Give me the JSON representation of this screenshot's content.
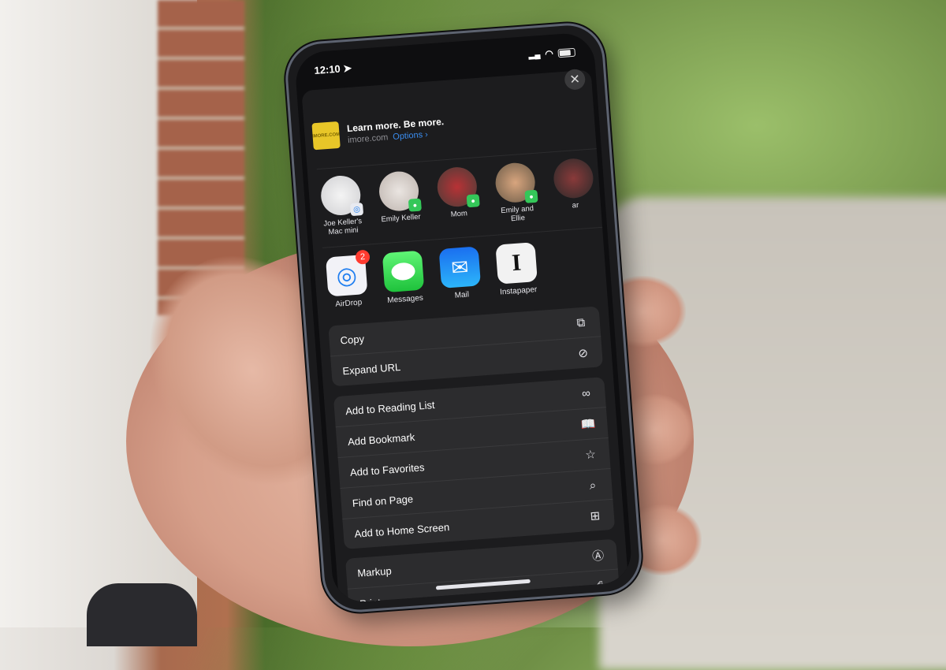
{
  "status_bar": {
    "time": "12:10",
    "location_arrow": "location-arrow-icon",
    "signal": "signal-icon",
    "wifi": "wifi-icon",
    "battery": "battery-icon"
  },
  "share_header": {
    "title": "Learn more. Be more.",
    "domain": "imore.com",
    "options_label": "Options ›",
    "thumbnail_label": "IMORE.COM",
    "close_label": "✕"
  },
  "people": [
    {
      "name": "Joe Keller's Mac mini",
      "badge": "airdrop"
    },
    {
      "name": "Emily Keller",
      "badge": "messages"
    },
    {
      "name": "Mom",
      "badge": "messages"
    },
    {
      "name": "Emily and Ellie",
      "badge": "messages"
    },
    {
      "name": "ar",
      "badge": "messages"
    }
  ],
  "apps": [
    {
      "name": "AirDrop",
      "badge_count": "2",
      "color": "#f2f2f7"
    },
    {
      "name": "Messages",
      "color": "#34c759"
    },
    {
      "name": "Mail",
      "color": "#1f8ef1"
    },
    {
      "name": "Instapaper",
      "color": "#f2f2f2",
      "glyph": "I"
    }
  ],
  "action_groups": [
    [
      {
        "label": "Copy",
        "icon": "⧉",
        "icon_name": "copy-icon"
      },
      {
        "label": "Expand URL",
        "icon": "⊘",
        "icon_name": "compass-icon"
      }
    ],
    [
      {
        "label": "Add to Reading List",
        "icon": "∞",
        "icon_name": "glasses-icon"
      },
      {
        "label": "Add Bookmark",
        "icon": "📖",
        "icon_name": "book-icon"
      },
      {
        "label": "Add to Favorites",
        "icon": "☆",
        "icon_name": "star-icon"
      },
      {
        "label": "Find on Page",
        "icon": "⌕",
        "icon_name": "search-icon"
      },
      {
        "label": "Add to Home Screen",
        "icon": "⊞",
        "icon_name": "add-square-icon"
      }
    ],
    [
      {
        "label": "Markup",
        "icon": "Ⓐ",
        "icon_name": "markup-icon"
      },
      {
        "label": "Print",
        "icon": "⎙",
        "icon_name": "printer-icon"
      }
    ]
  ]
}
